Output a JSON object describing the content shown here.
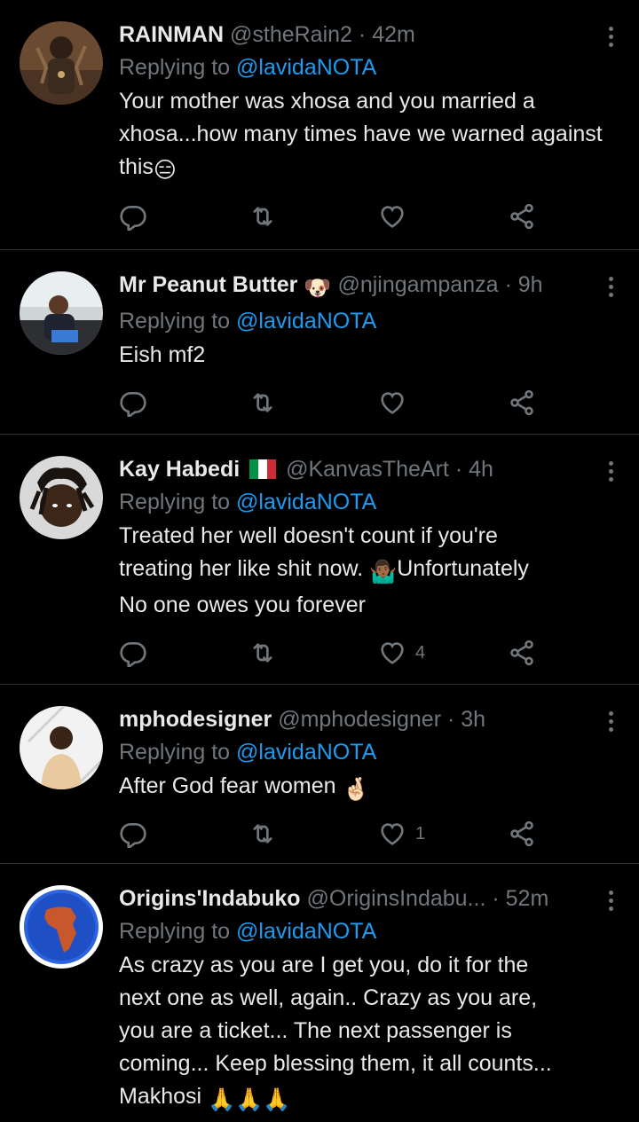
{
  "tweets": [
    {
      "name": "RAINMAN",
      "handle": "@stheRain2",
      "dot": "·",
      "time": "42m",
      "replying_prefix": "Replying to",
      "replying_to": "@lavidaNOTA",
      "body": "Your mother was xhosa and you married a xhosa...how many times have we warned against this",
      "body_emoji": "😑",
      "likes": "",
      "avatar_icon": "avatar-costume-icon"
    },
    {
      "name": "Mr Peanut Butter",
      "name_emoji": "🐶",
      "handle": "@njingampanza",
      "dot": "·",
      "time": "9h",
      "replying_prefix": "Replying to",
      "replying_to": "@lavidaNOTA",
      "body": "Eish mf2",
      "likes": "",
      "avatar_icon": "avatar-car-icon"
    },
    {
      "name": "Kay Habedi",
      "name_flag": "italy-flag-icon",
      "handle": "@KanvasTheArt",
      "dot": "·",
      "time": "4h",
      "replying_prefix": "Replying to",
      "replying_to": "@lavidaNOTA",
      "body_line1": "Treated her well doesn't count if you're",
      "body_line2a": "treating her like shit now. ",
      "body_emoji": "🤷🏾‍♂️",
      "body_line2b": "Unfortunately",
      "body_line3": "No one owes you forever",
      "likes": "4",
      "avatar_icon": "avatar-dreads-icon"
    },
    {
      "name": "mphodesigner",
      "handle": "@mphodesigner",
      "dot": "·",
      "time": "3h",
      "replying_prefix": "Replying to",
      "replying_to": "@lavidaNOTA",
      "body": "After God fear women ",
      "body_emoji": "🤞🏻",
      "likes": "1",
      "avatar_icon": "avatar-portrait-icon"
    },
    {
      "name": "Origins'Indabuko",
      "handle": "@OriginsIndabu...",
      "dot": "·",
      "time": "52m",
      "replying_prefix": "Replying to",
      "replying_to": "@lavidaNOTA",
      "body_lines": [
        "As crazy as you are I get you, do it for the",
        "next one as well, again.. Crazy as you are,",
        "you are a ticket... The next passenger is",
        "coming... Keep blessing them, it all counts..."
      ],
      "body_last": "Makhosi ",
      "body_emoji": "🙏🙏🙏",
      "avatar_icon": "avatar-africa-map-icon"
    }
  ],
  "colors": {
    "background": "#000000",
    "text": "#e7e9ea",
    "muted": "#71767b",
    "link": "#1d9bf0",
    "divider": "#2f3336"
  }
}
